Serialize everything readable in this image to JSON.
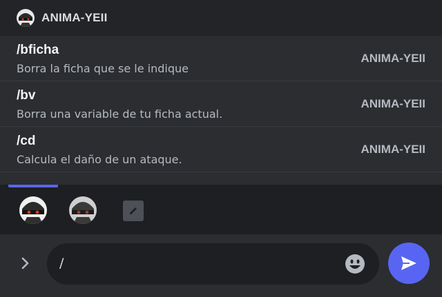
{
  "popup": {
    "header": {
      "title": "ANIMA-YEII",
      "avatar_icon": "bot-avatar-icon"
    },
    "commands": [
      {
        "name": "/bficha",
        "description": "Borra la ficha que se le indique",
        "source": "ANIMA-YEII"
      },
      {
        "name": "/bv",
        "description": "Borra una variable de tu ficha actual.",
        "source": "ANIMA-YEII"
      },
      {
        "name": "/cd",
        "description": "Calcula el daño de un ataque.",
        "source": "ANIMA-YEII"
      }
    ]
  },
  "tray": {
    "items": [
      "bot-avatar-icon",
      "bot-avatar-icon",
      "pencil-icon"
    ],
    "accent": "#5865f2"
  },
  "composer": {
    "input_value": "/",
    "icons": {
      "expand": "chevron-right-icon",
      "emoji": "emoji-icon",
      "send": "send-icon"
    }
  },
  "colors": {
    "background": "#313338",
    "popup": "#2b2d31",
    "tray": "#1e1f22",
    "accent": "#5865f2"
  }
}
